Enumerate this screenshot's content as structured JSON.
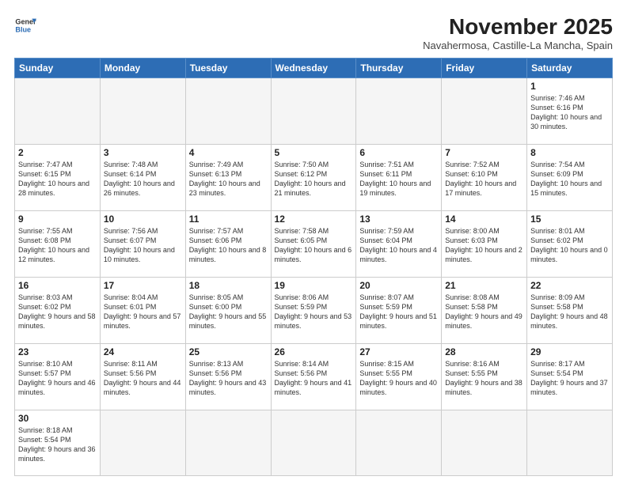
{
  "header": {
    "logo_general": "General",
    "logo_blue": "Blue",
    "month_title": "November 2025",
    "subtitle": "Navahermosa, Castille-La Mancha, Spain"
  },
  "weekdays": [
    "Sunday",
    "Monday",
    "Tuesday",
    "Wednesday",
    "Thursday",
    "Friday",
    "Saturday"
  ],
  "weeks": [
    [
      {
        "day": "",
        "info": ""
      },
      {
        "day": "",
        "info": ""
      },
      {
        "day": "",
        "info": ""
      },
      {
        "day": "",
        "info": ""
      },
      {
        "day": "",
        "info": ""
      },
      {
        "day": "",
        "info": ""
      },
      {
        "day": "1",
        "info": "Sunrise: 7:46 AM\nSunset: 6:16 PM\nDaylight: 10 hours\nand 30 minutes."
      }
    ],
    [
      {
        "day": "2",
        "info": "Sunrise: 7:47 AM\nSunset: 6:15 PM\nDaylight: 10 hours\nand 28 minutes."
      },
      {
        "day": "3",
        "info": "Sunrise: 7:48 AM\nSunset: 6:14 PM\nDaylight: 10 hours\nand 26 minutes."
      },
      {
        "day": "4",
        "info": "Sunrise: 7:49 AM\nSunset: 6:13 PM\nDaylight: 10 hours\nand 23 minutes."
      },
      {
        "day": "5",
        "info": "Sunrise: 7:50 AM\nSunset: 6:12 PM\nDaylight: 10 hours\nand 21 minutes."
      },
      {
        "day": "6",
        "info": "Sunrise: 7:51 AM\nSunset: 6:11 PM\nDaylight: 10 hours\nand 19 minutes."
      },
      {
        "day": "7",
        "info": "Sunrise: 7:52 AM\nSunset: 6:10 PM\nDaylight: 10 hours\nand 17 minutes."
      },
      {
        "day": "8",
        "info": "Sunrise: 7:54 AM\nSunset: 6:09 PM\nDaylight: 10 hours\nand 15 minutes."
      }
    ],
    [
      {
        "day": "9",
        "info": "Sunrise: 7:55 AM\nSunset: 6:08 PM\nDaylight: 10 hours\nand 12 minutes."
      },
      {
        "day": "10",
        "info": "Sunrise: 7:56 AM\nSunset: 6:07 PM\nDaylight: 10 hours\nand 10 minutes."
      },
      {
        "day": "11",
        "info": "Sunrise: 7:57 AM\nSunset: 6:06 PM\nDaylight: 10 hours\nand 8 minutes."
      },
      {
        "day": "12",
        "info": "Sunrise: 7:58 AM\nSunset: 6:05 PM\nDaylight: 10 hours\nand 6 minutes."
      },
      {
        "day": "13",
        "info": "Sunrise: 7:59 AM\nSunset: 6:04 PM\nDaylight: 10 hours\nand 4 minutes."
      },
      {
        "day": "14",
        "info": "Sunrise: 8:00 AM\nSunset: 6:03 PM\nDaylight: 10 hours\nand 2 minutes."
      },
      {
        "day": "15",
        "info": "Sunrise: 8:01 AM\nSunset: 6:02 PM\nDaylight: 10 hours\nand 0 minutes."
      }
    ],
    [
      {
        "day": "16",
        "info": "Sunrise: 8:03 AM\nSunset: 6:02 PM\nDaylight: 9 hours\nand 58 minutes."
      },
      {
        "day": "17",
        "info": "Sunrise: 8:04 AM\nSunset: 6:01 PM\nDaylight: 9 hours\nand 57 minutes."
      },
      {
        "day": "18",
        "info": "Sunrise: 8:05 AM\nSunset: 6:00 PM\nDaylight: 9 hours\nand 55 minutes."
      },
      {
        "day": "19",
        "info": "Sunrise: 8:06 AM\nSunset: 5:59 PM\nDaylight: 9 hours\nand 53 minutes."
      },
      {
        "day": "20",
        "info": "Sunrise: 8:07 AM\nSunset: 5:59 PM\nDaylight: 9 hours\nand 51 minutes."
      },
      {
        "day": "21",
        "info": "Sunrise: 8:08 AM\nSunset: 5:58 PM\nDaylight: 9 hours\nand 49 minutes."
      },
      {
        "day": "22",
        "info": "Sunrise: 8:09 AM\nSunset: 5:58 PM\nDaylight: 9 hours\nand 48 minutes."
      }
    ],
    [
      {
        "day": "23",
        "info": "Sunrise: 8:10 AM\nSunset: 5:57 PM\nDaylight: 9 hours\nand 46 minutes."
      },
      {
        "day": "24",
        "info": "Sunrise: 8:11 AM\nSunset: 5:56 PM\nDaylight: 9 hours\nand 44 minutes."
      },
      {
        "day": "25",
        "info": "Sunrise: 8:13 AM\nSunset: 5:56 PM\nDaylight: 9 hours\nand 43 minutes."
      },
      {
        "day": "26",
        "info": "Sunrise: 8:14 AM\nSunset: 5:56 PM\nDaylight: 9 hours\nand 41 minutes."
      },
      {
        "day": "27",
        "info": "Sunrise: 8:15 AM\nSunset: 5:55 PM\nDaylight: 9 hours\nand 40 minutes."
      },
      {
        "day": "28",
        "info": "Sunrise: 8:16 AM\nSunset: 5:55 PM\nDaylight: 9 hours\nand 38 minutes."
      },
      {
        "day": "29",
        "info": "Sunrise: 8:17 AM\nSunset: 5:54 PM\nDaylight: 9 hours\nand 37 minutes."
      }
    ],
    [
      {
        "day": "30",
        "info": "Sunrise: 8:18 AM\nSunset: 5:54 PM\nDaylight: 9 hours\nand 36 minutes."
      },
      {
        "day": "",
        "info": ""
      },
      {
        "day": "",
        "info": ""
      },
      {
        "day": "",
        "info": ""
      },
      {
        "day": "",
        "info": ""
      },
      {
        "day": "",
        "info": ""
      },
      {
        "day": "",
        "info": ""
      }
    ]
  ]
}
